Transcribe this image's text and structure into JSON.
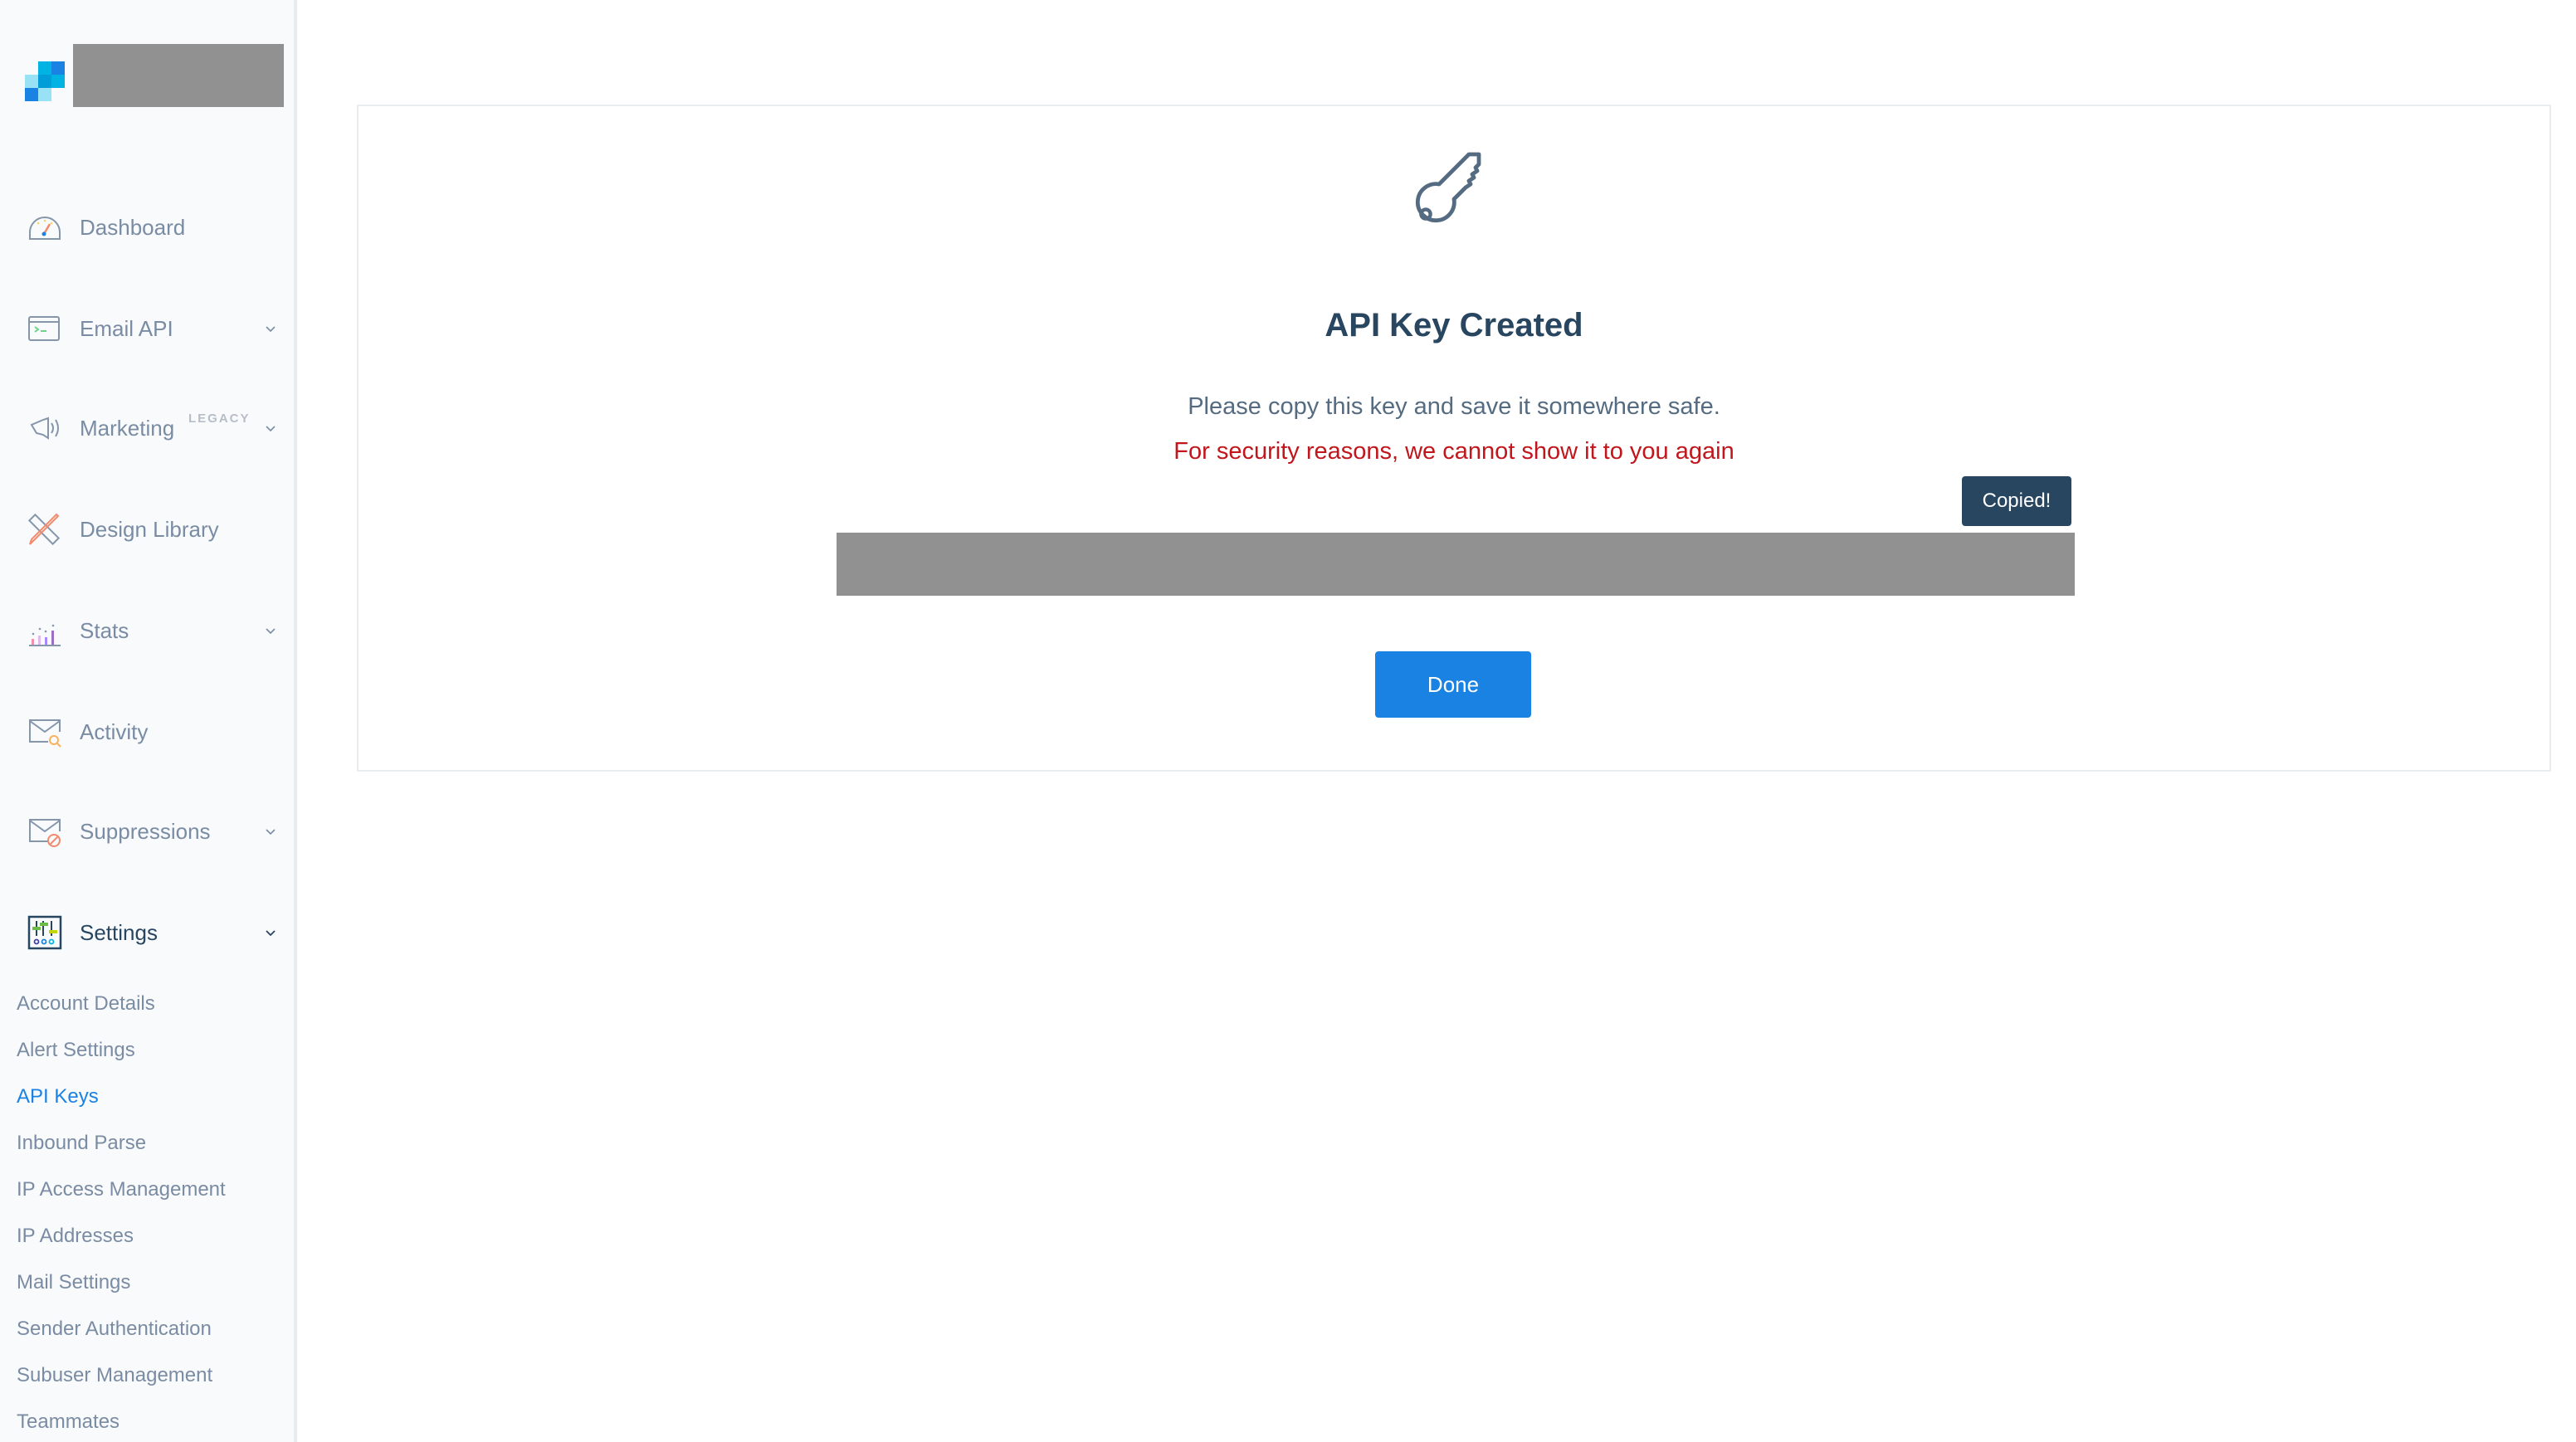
{
  "brand": {
    "logo_icon": "twilio-sendgrid-logo",
    "name_redacted": true
  },
  "sidebar": {
    "items": [
      {
        "label": "Dashboard",
        "icon": "speedometer-icon",
        "has_chevron": false
      },
      {
        "label": "Email API",
        "icon": "terminal-window-icon",
        "has_chevron": true
      },
      {
        "label": "Marketing",
        "badge": "LEGACY",
        "icon": "megaphone-icon",
        "has_chevron": true
      },
      {
        "label": "Design Library",
        "icon": "pencil-ruler-icon",
        "has_chevron": false
      },
      {
        "label": "Stats",
        "icon": "bar-chart-icon",
        "has_chevron": true
      },
      {
        "label": "Activity",
        "icon": "envelope-search-icon",
        "has_chevron": false
      },
      {
        "label": "Suppressions",
        "icon": "envelope-blocked-icon",
        "has_chevron": true
      },
      {
        "label": "Settings",
        "icon": "sliders-icon",
        "has_chevron": true,
        "expanded": true
      }
    ],
    "settings_subitems": [
      {
        "label": "Account Details"
      },
      {
        "label": "Alert Settings"
      },
      {
        "label": "API Keys",
        "active": true
      },
      {
        "label": "Inbound Parse"
      },
      {
        "label": "IP Access Management"
      },
      {
        "label": "IP Addresses"
      },
      {
        "label": "Mail Settings"
      },
      {
        "label": "Sender Authentication"
      },
      {
        "label": "Subuser Management"
      },
      {
        "label": "Teammates"
      }
    ]
  },
  "dialog": {
    "icon": "key-icon",
    "title": "API Key Created",
    "message": "Please copy this key and save it somewhere safe.",
    "warning": "For security reasons, we cannot show it to you again",
    "tooltip": "Copied!",
    "key_value_redacted": true,
    "done_label": "Done"
  },
  "colors": {
    "accent": "#1a82e2",
    "heading": "#294661",
    "warning": "#c0161c",
    "sidebar_bg": "#f9fafc",
    "muted_text": "#7a8ca3"
  }
}
